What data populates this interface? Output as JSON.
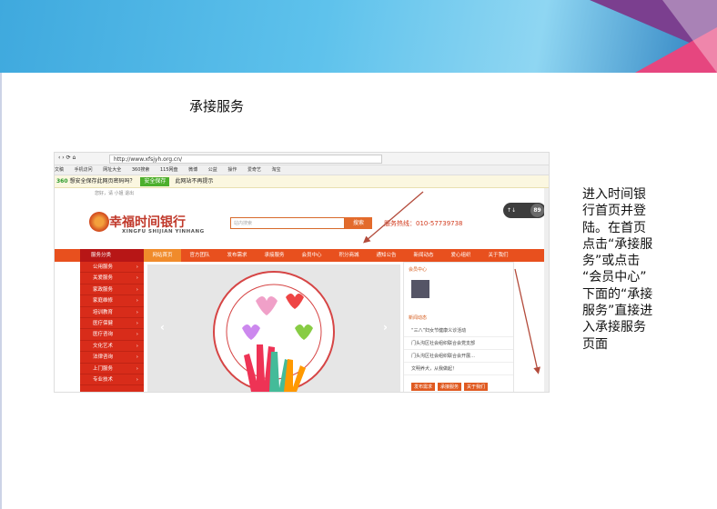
{
  "slide": {
    "title": "承接服务",
    "description": "进入时间银\n行首页并登\n陆。在首页\n点击“承接服\n务”或点击\n  “会员中心”\n下面的“承接\n服务”直接进\n入承接服务\n页面"
  },
  "browser": {
    "url": "http://www.xfsjyh.org.cn/",
    "bookmarks": [
      "文稿",
      "手机访问",
      "网址大全",
      "360搜索",
      "115网盘",
      "微博",
      "公益",
      "操作",
      "爱奇艺",
      "淘宝"
    ],
    "safe_text": "想安全保存此网页密码吗？",
    "safe_button": "安全保存",
    "safe_no": "此网站不再提示"
  },
  "site": {
    "topbar_text": "您好，请 小姐 退出",
    "brand_cn": "幸福时间银行",
    "brand_en": "XINGFU SHIJIAN YINHANG",
    "search_placeholder": "站内搜索",
    "search_button": "搜索",
    "hotline": "服务热线：010-57739738",
    "speed": "89",
    "category_label": "服务分类",
    "nav_items": [
      "网站首页",
      "官方团队",
      "发布需求",
      "承接服务",
      "会员中心",
      "积分商城",
      "通知公告",
      "新闻动态",
      "爱心组织",
      "关于我们"
    ],
    "side_items": [
      "公用服务",
      "关爱服务",
      "家政服务",
      "家庭维修",
      "培训教育",
      "医疗保健",
      "医疗咨询",
      "文化艺术",
      "法律咨询",
      "上门服务",
      "专业技术"
    ],
    "right_title": "会员中心",
    "news_title": "新闻动态",
    "news_items": [
      "“三八”妇女节健康义诊活动",
      "门头沟区社会组织联合会党支部",
      "门头沟区社会组织联合会开展…",
      "文明养犬，从我做起！"
    ],
    "right_buttons": [
      "发布需求",
      "承接服务",
      "关于我们"
    ]
  }
}
